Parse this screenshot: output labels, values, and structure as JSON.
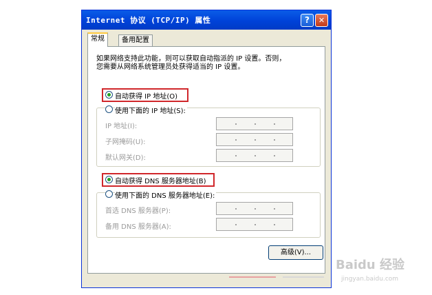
{
  "window": {
    "title": "Internet 协议 (TCP/IP) 属性",
    "help_icon": "?",
    "close_icon": "✕"
  },
  "tabs": [
    {
      "label": "常规",
      "active": true
    },
    {
      "label": "备用配置",
      "active": false
    }
  ],
  "description": {
    "line1": "如果网络支持此功能，则可以获取自动指派的 IP 设置。否则，",
    "line2": "您需要从网络系统管理员处获得适当的 IP 设置。"
  },
  "ip": {
    "auto_label": "自动获得 IP 地址(O)",
    "auto_selected": true,
    "manual_label": "使用下面的 IP 地址(S):",
    "manual_selected": false,
    "fields": [
      {
        "label": "IP 地址(I):",
        "value": ""
      },
      {
        "label": "子网掩码(U):",
        "value": ""
      },
      {
        "label": "默认网关(D):",
        "value": ""
      }
    ]
  },
  "dns": {
    "auto_label": "自动获得 DNS 服务器地址(B)",
    "auto_selected": true,
    "manual_label": "使用下面的 DNS 服务器地址(E):",
    "manual_selected": false,
    "fields": [
      {
        "label": "首选 DNS 服务器(P):",
        "value": ""
      },
      {
        "label": "备用 DNS 服务器(A):",
        "value": ""
      }
    ]
  },
  "buttons": {
    "advanced": "高级(V)..."
  },
  "watermark": {
    "logo": "Baidu 经验",
    "url": "jingyan.baidu.com"
  },
  "colors": {
    "titlebar": "#0042D8",
    "highlight_box": "#D0262A",
    "radio_dot": "#21A121"
  }
}
